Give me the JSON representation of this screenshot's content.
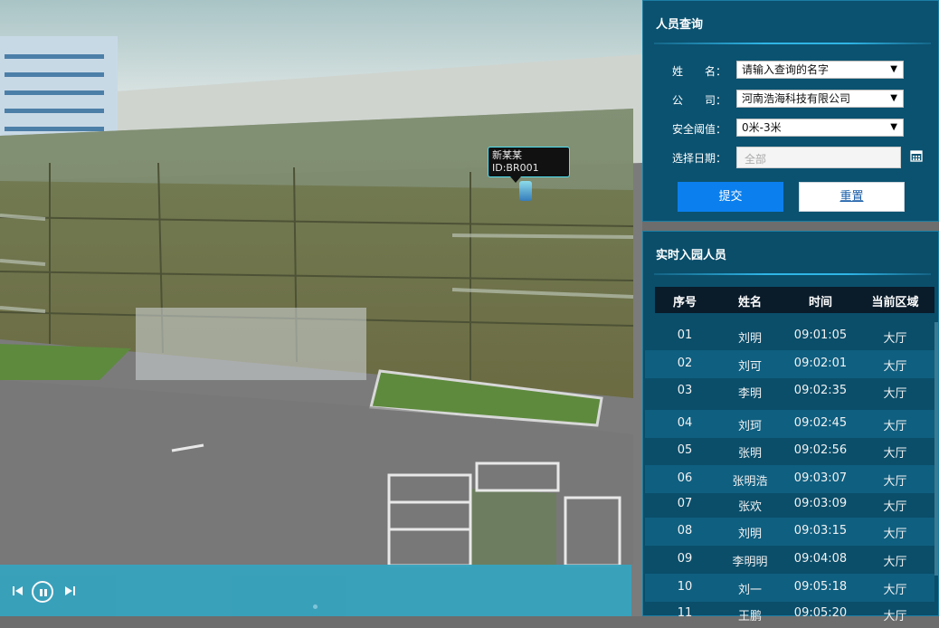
{
  "scene": {
    "tooltip": {
      "name_line": "新某某",
      "id_line": "ID:BR001"
    }
  },
  "query_panel": {
    "title": "人员查询",
    "fields": {
      "name": {
        "label": "姓　　名：",
        "value": "请输入查询的名字"
      },
      "company": {
        "label": "公　　司：",
        "value": "河南浩海科技有限公司"
      },
      "threshold": {
        "label": "安全阈值：",
        "value": "0米-3米"
      },
      "date": {
        "label": "选择日期：",
        "placeholder": "全部"
      }
    },
    "submit_label": "提交",
    "reset_label": "重置"
  },
  "live_panel": {
    "title": "实时入园人员",
    "columns": [
      "序号",
      "姓名",
      "时间",
      "当前区域"
    ],
    "rows": [
      [
        "01",
        "刘明",
        "09:01:05",
        "大厅"
      ],
      [
        "02",
        "刘可",
        "09:02:01",
        "大厅"
      ],
      [
        "03",
        "李明",
        "09:02:35",
        "大厅"
      ],
      [
        "04",
        "刘珂",
        "09:02:45",
        "大厅"
      ],
      [
        "05",
        "张明",
        "09:02:56",
        "大厅"
      ],
      [
        "06",
        "张明浩",
        "09:03:07",
        "大厅"
      ],
      [
        "07",
        "张欢",
        "09:03:09",
        "大厅"
      ],
      [
        "08",
        "刘明",
        "09:03:15",
        "大厅"
      ],
      [
        "09",
        "李明明",
        "09:04:08",
        "大厅"
      ],
      [
        "10",
        "刘一",
        "09:05:18",
        "大厅"
      ],
      [
        "11",
        "王鹏",
        "09:05:20",
        "大厅"
      ]
    ]
  },
  "icons": {
    "calendar": "calendar-icon",
    "prev": "skip-previous-icon",
    "pause": "pause-icon",
    "next": "skip-next-icon",
    "caret": "chevron-down-icon"
  },
  "colors": {
    "panel_bg": "#0b5270",
    "submit_bg": "#0b7fee",
    "playbar_bg": "#37a2bd",
    "tooltip_border": "#4ee0f2"
  }
}
